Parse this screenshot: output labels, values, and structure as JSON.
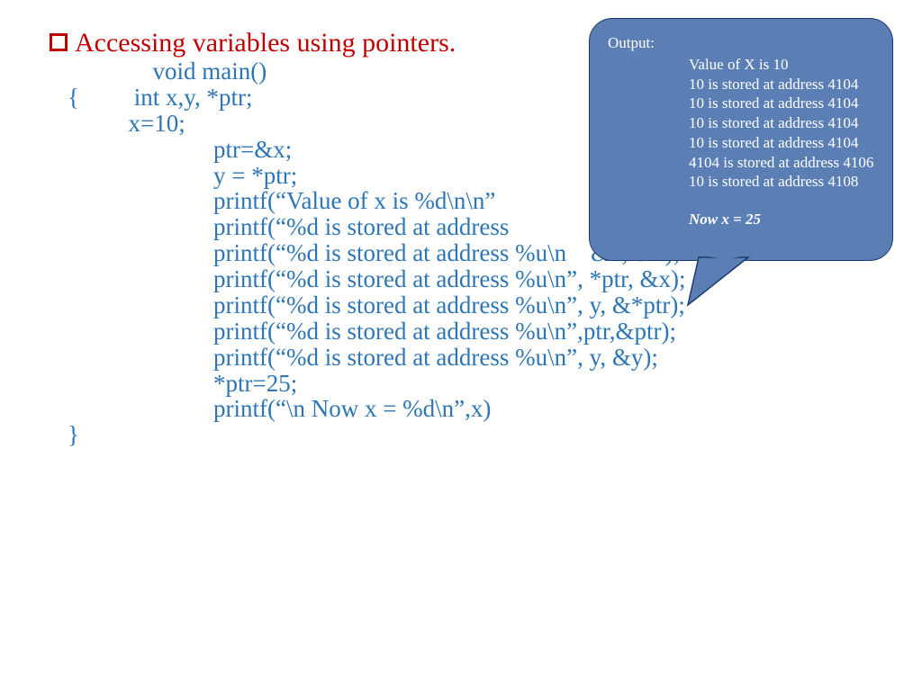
{
  "title": "Accessing variables using pointers.",
  "code": "              void main()\n{         int x,y, *ptr;\n          x=10;\n                        ptr=&x;\n                        y = *ptr;\n                        printf(“Value of x is %d\\n\\n”\n                        printf(“%d is stored at address\n                        printf(“%d is stored at address %u\\n    &x, &x);\n                        printf(“%d is stored at address %u\\n”, *ptr, &x);\n                        printf(“%d is stored at address %u\\n”, y, &*ptr);\n                        printf(“%d is stored at address %u\\n”,ptr,&ptr);\n                        printf(“%d is stored at address %u\\n”, y, &y);\n                        *ptr=25;\n                        printf(“\\n Now x = %d\\n”,x)\n}",
  "output": {
    "heading": "Output:",
    "lines": [
      "Value of X is 10",
      "10 is stored at address 4104",
      "10 is stored at address 4104",
      "10 is stored at address 4104",
      "10 is stored at address 4104",
      "4104 is stored at address 4106",
      "10 is stored at address 4108"
    ],
    "final": "Now x = 25"
  }
}
